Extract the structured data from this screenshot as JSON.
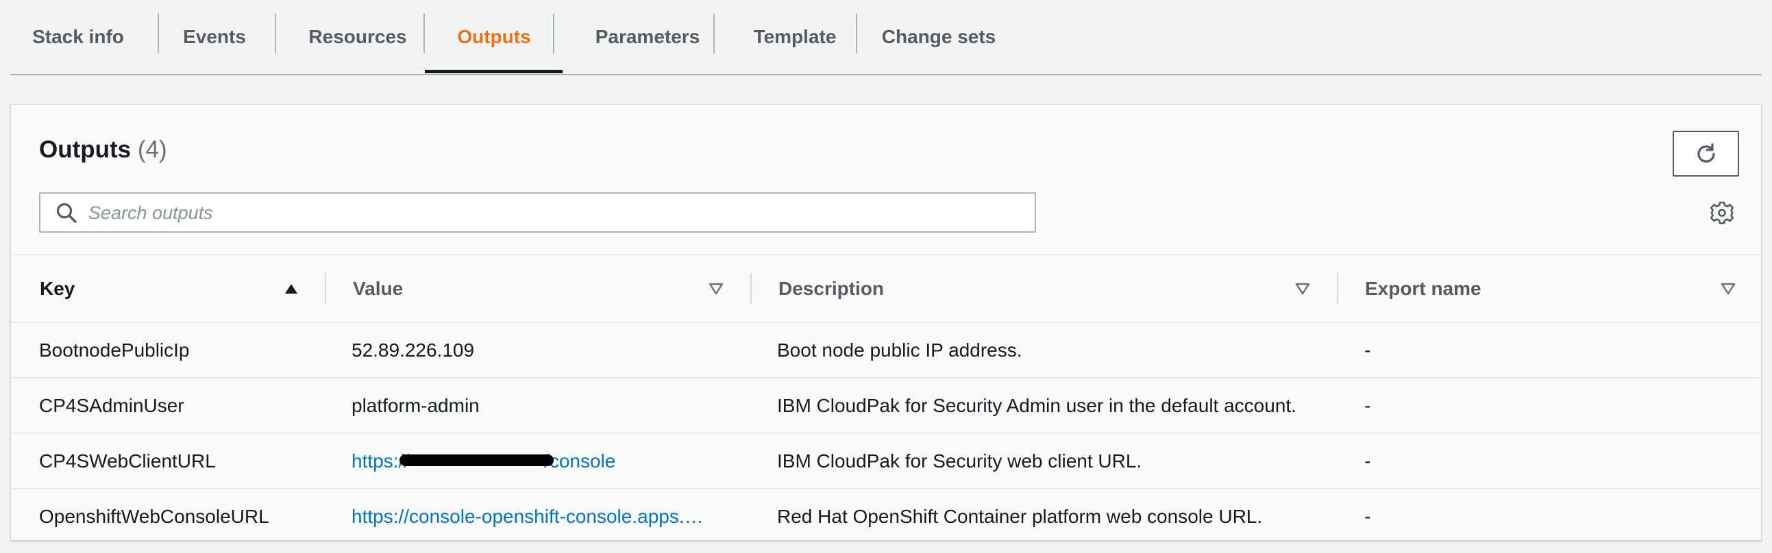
{
  "tabs": [
    {
      "label": "Stack info"
    },
    {
      "label": "Events"
    },
    {
      "label": "Resources"
    },
    {
      "label": "Outputs"
    },
    {
      "label": "Parameters"
    },
    {
      "label": "Template"
    },
    {
      "label": "Change sets"
    }
  ],
  "active_tab": "Outputs",
  "accent_color": "#ec7211",
  "link_color": "#0073bb",
  "panel": {
    "title": "Outputs",
    "count": "(4)",
    "refresh_icon": "refresh-icon",
    "settings_icon": "gear-icon"
  },
  "search": {
    "placeholder": "Search outputs",
    "value": ""
  },
  "table": {
    "columns": [
      {
        "label": "Key",
        "sort": "ascending"
      },
      {
        "label": "Value",
        "sort": "none"
      },
      {
        "label": "Description",
        "sort": "none"
      },
      {
        "label": "Export name",
        "sort": "none"
      }
    ],
    "rows": [
      {
        "key": "BootnodePublicIp",
        "value": "52.89.226.109",
        "description": "Boot node public IP address.",
        "export": "-"
      },
      {
        "key": "CP4SAdminUser",
        "value": "platform-admin",
        "description": "IBM CloudPak for Security Admin user in the default account.",
        "export": "-"
      },
      {
        "key": "CP4SWebClientURL",
        "value_prefix": "https://",
        "value_suffix": "/console",
        "value_redacted": true,
        "description": "IBM CloudPak for Security web client URL.",
        "export": "-"
      },
      {
        "key": "OpenshiftWebConsoleURL",
        "value": "https://console-openshift-console.apps.…",
        "description": "Red Hat OpenShift Container platform web console URL.",
        "export": "-"
      }
    ]
  }
}
